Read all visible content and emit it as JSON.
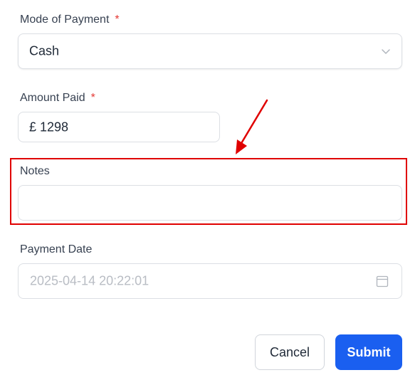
{
  "form": {
    "mode_of_payment": {
      "label": "Mode of Payment",
      "required_mark": "*",
      "value": "Cash"
    },
    "amount_paid": {
      "label": "Amount Paid",
      "required_mark": "*",
      "currency_symbol": "£",
      "value": "1298",
      "display": "£ 1298"
    },
    "notes": {
      "label": "Notes",
      "value": ""
    },
    "payment_date": {
      "label": "Payment Date",
      "placeholder": "2025-04-14 20:22:01"
    }
  },
  "actions": {
    "cancel_label": "Cancel",
    "submit_label": "Submit"
  },
  "annotation": {
    "highlight_color": "#e00000"
  },
  "colors": {
    "primary": "#1a5ff0",
    "required": "#e53935"
  }
}
